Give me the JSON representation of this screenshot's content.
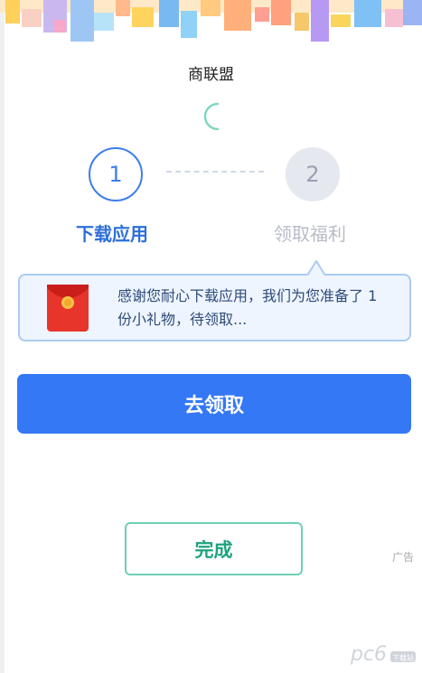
{
  "header": {
    "title": "商联盟"
  },
  "steps": [
    {
      "number": "1",
      "label": "下载应用",
      "state": "active"
    },
    {
      "number": "2",
      "label": "领取福利",
      "state": "pending"
    }
  ],
  "info": {
    "icon": "red-envelope-icon",
    "message": "感谢您耐心下载应用，我们为您准备了 1 份小礼物，待领取..."
  },
  "actions": {
    "claim_label": "去领取",
    "done_label": "完成"
  },
  "ad_label": "广告",
  "watermark": {
    "text": "pc6",
    "suffix": "下载站"
  },
  "colors": {
    "primary": "#3478f6",
    "step_active": "#3d7df0",
    "done_green": "#1ea37f",
    "info_bg": "#eef5ff"
  }
}
